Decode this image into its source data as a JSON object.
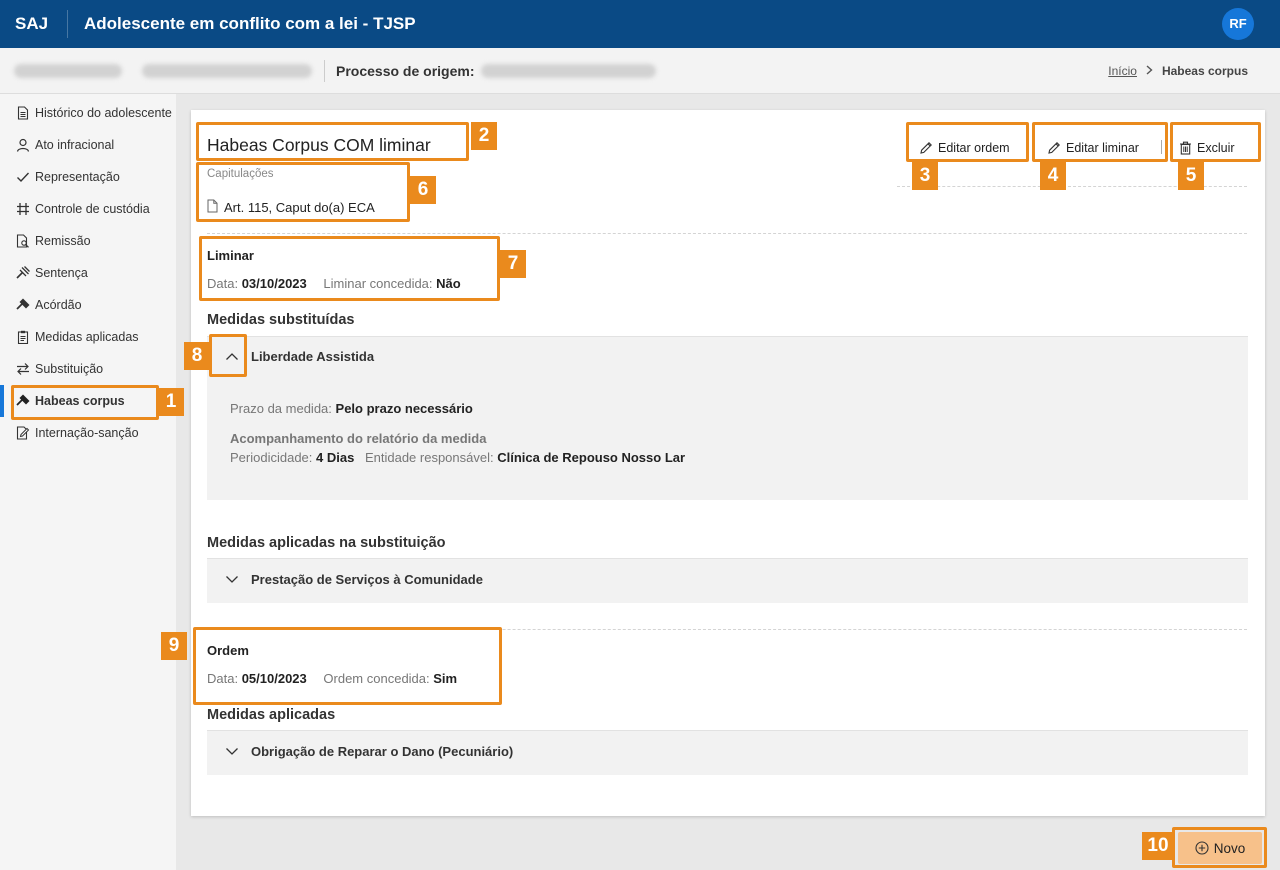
{
  "header": {
    "brand": "SAJ",
    "title": "Adolescente em conflito com a lei - TJSP",
    "user_initials": "RF"
  },
  "subheader": {
    "origin_label": "Processo de origem:",
    "breadcrumb": {
      "home": "Início",
      "current": "Habeas corpus"
    }
  },
  "sidebar": {
    "items": [
      {
        "label": "Histórico do adolescente",
        "icon": "document-icon"
      },
      {
        "label": "Ato infracional",
        "icon": "person-icon"
      },
      {
        "label": "Representação",
        "icon": "check-icon"
      },
      {
        "label": "Controle de custódia",
        "icon": "hash-icon"
      },
      {
        "label": "Remissão",
        "icon": "document-search-icon"
      },
      {
        "label": "Sentença",
        "icon": "gavel-icon"
      },
      {
        "label": "Acórdão",
        "icon": "gavel-icon"
      },
      {
        "label": "Medidas aplicadas",
        "icon": "clipboard-icon"
      },
      {
        "label": "Substituição",
        "icon": "swap-icon"
      },
      {
        "label": "Habeas corpus",
        "icon": "gavel-icon",
        "active": true
      },
      {
        "label": "Internação-sanção",
        "icon": "document-edit-icon"
      }
    ]
  },
  "habeas": {
    "title": "Habeas Corpus COM liminar",
    "capitulacoes_label": "Capitulações",
    "capitulacao": "Art. 115, Caput do(a) ECA",
    "actions": {
      "edit_order": "Editar ordem",
      "edit_liminar": "Editar liminar",
      "delete": "Excluir"
    },
    "liminar": {
      "title": "Liminar",
      "date_label": "Data:",
      "date": "03/10/2023",
      "granted_label": "Liminar concedida:",
      "granted": "Não"
    },
    "medidas_substituidas": {
      "title": "Medidas substituídas",
      "item": {
        "name": "Liberdade Assistida",
        "prazo_label": "Prazo da medida:",
        "prazo": "Pelo prazo necessário",
        "acomp_title": "Acompanhamento do relatório da medida",
        "period_label": "Periodicidade:",
        "period": "4 Dias",
        "entity_label": "Entidade responsável:",
        "entity": "Clínica de Repouso Nosso Lar"
      }
    },
    "medidas_aplicadas_substituicao": {
      "title": "Medidas aplicadas na substituição",
      "item": "Prestação de Serviços à Comunidade"
    },
    "ordem": {
      "title": "Ordem",
      "date_label": "Data:",
      "date": "05/10/2023",
      "granted_label": "Ordem concedida:",
      "granted": "Sim"
    },
    "medidas_aplicadas": {
      "title": "Medidas aplicadas",
      "item": "Obrigação de Reparar o Dano (Pecuniário)"
    }
  },
  "new_button": "Novo",
  "callouts": [
    "1",
    "2",
    "3",
    "4",
    "5",
    "6",
    "7",
    "8",
    "9",
    "10"
  ],
  "colors": {
    "header": "#0a4a85",
    "accent": "#1677d9",
    "highlight": "#ea8a1d",
    "new_button": "#f7c18a"
  }
}
